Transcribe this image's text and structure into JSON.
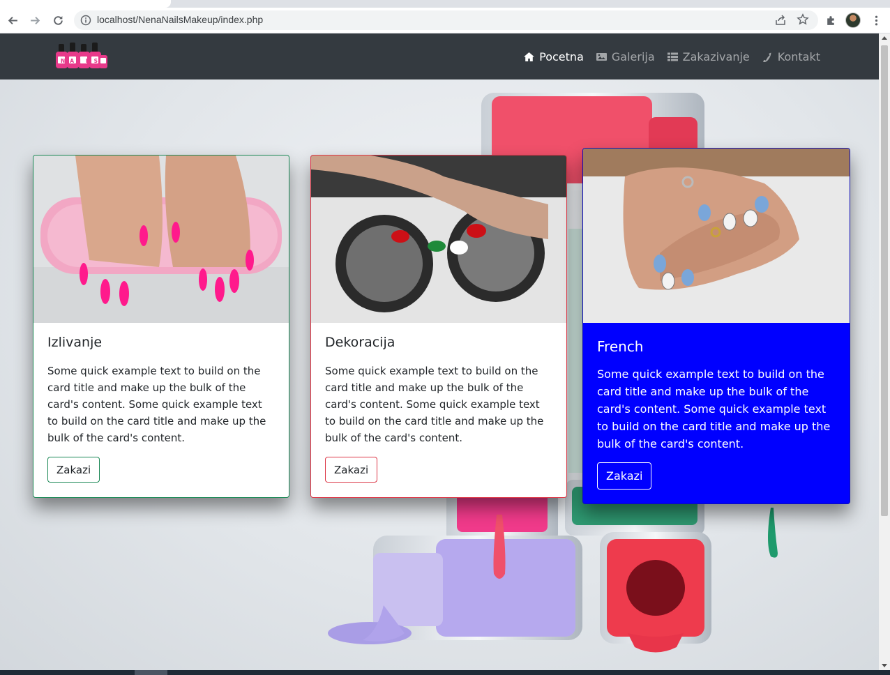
{
  "browser": {
    "url": "localhost/NenaNailsMakeup/index.php",
    "icons": [
      "back-arrow-icon",
      "forward-arrow-icon",
      "reload-icon",
      "site-info-icon",
      "share-icon",
      "bookmark-star-icon",
      "extensions-icon",
      "profile-avatar",
      "kebab-menu-icon"
    ]
  },
  "site": {
    "logo_text": "NAILS",
    "nav": [
      {
        "label": "Pocetna",
        "icon": "home-icon",
        "active": true
      },
      {
        "label": "Galerija",
        "icon": "image-icon",
        "active": false
      },
      {
        "label": "Zakazivanje",
        "icon": "list-icon",
        "active": false
      },
      {
        "label": "Kontakt",
        "icon": "phone-icon",
        "active": false
      }
    ]
  },
  "cards": [
    {
      "title": "Izlivanje",
      "text": "Some quick example text to build on the card title and make up the bulk of the card's content. Some quick example text to build on the card title and make up the bulk of the card's content.",
      "button": "Zakazi",
      "border_color": "#198754"
    },
    {
      "title": "Dekoracija",
      "text": "Some quick example text to build on the card title and make up the bulk of the card's content. Some quick example text to build on the card title and make up the bulk of the card's content.",
      "button": "Zakazi",
      "border_color": "#dc3545"
    },
    {
      "title": "French",
      "text": "Some quick example text to build on the card title and make up the bulk of the card's content. Some quick example text to build on the card title and make up the bulk of the card's content.",
      "button": "Zakazi",
      "background_color": "#0000ff"
    }
  ],
  "colors": {
    "navbar": "#343a40",
    "accent_pink": "#ff1a8c"
  }
}
